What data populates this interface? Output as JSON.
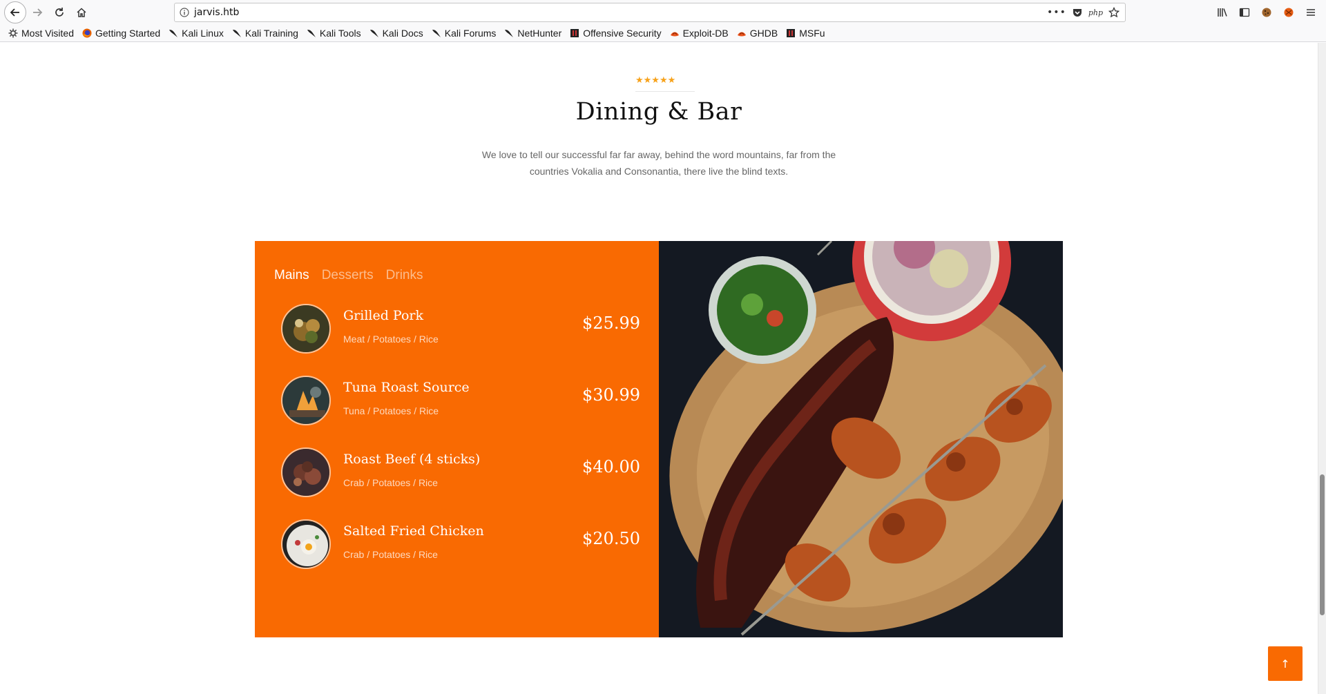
{
  "browser": {
    "url": "jarvis.htb",
    "bookmarks": [
      {
        "label": "Most Visited",
        "icon": "gear-icon"
      },
      {
        "label": "Getting Started",
        "icon": "firefox-icon"
      },
      {
        "label": "Kali Linux",
        "icon": "kali-dragon-icon"
      },
      {
        "label": "Kali Training",
        "icon": "kali-dragon-icon"
      },
      {
        "label": "Kali Tools",
        "icon": "kali-dragon-icon"
      },
      {
        "label": "Kali Docs",
        "icon": "kali-dragon-icon"
      },
      {
        "label": "Kali Forums",
        "icon": "kali-dragon-icon"
      },
      {
        "label": "NetHunter",
        "icon": "kali-dragon-icon"
      },
      {
        "label": "Offensive Security",
        "icon": "offsec-icon"
      },
      {
        "label": "Exploit-DB",
        "icon": "exploitdb-icon"
      },
      {
        "label": "GHDB",
        "icon": "exploitdb-icon"
      },
      {
        "label": "MSFu",
        "icon": "offsec-icon"
      }
    ]
  },
  "section": {
    "stars": "★★★★★",
    "title": "Dining & Bar",
    "description": "We love to tell our successful far far away, behind the word mountains, far from the countries Vokalia and Consonantia, there live the blind texts."
  },
  "menu": {
    "tabs": [
      {
        "label": "Mains",
        "active": true
      },
      {
        "label": "Desserts",
        "active": false
      },
      {
        "label": "Drinks",
        "active": false
      }
    ],
    "items": [
      {
        "name": "Grilled Pork",
        "ingredients": "Meat / Potatoes / Rice",
        "price": "$25.99"
      },
      {
        "name": "Tuna Roast Source",
        "ingredients": "Tuna / Potatoes / Rice",
        "price": "$30.99"
      },
      {
        "name": "Roast Beef (4 sticks)",
        "ingredients": "Crab / Potatoes / Rice",
        "price": "$40.00"
      },
      {
        "name": "Salted Fried Chicken",
        "ingredients": "Crab / Potatoes / Rice",
        "price": "$20.50"
      }
    ]
  },
  "colors": {
    "accent": "#f96a02",
    "star": "#f7a21b"
  },
  "scroll_top": {
    "icon": "arrow-up-icon",
    "label": "↑"
  }
}
